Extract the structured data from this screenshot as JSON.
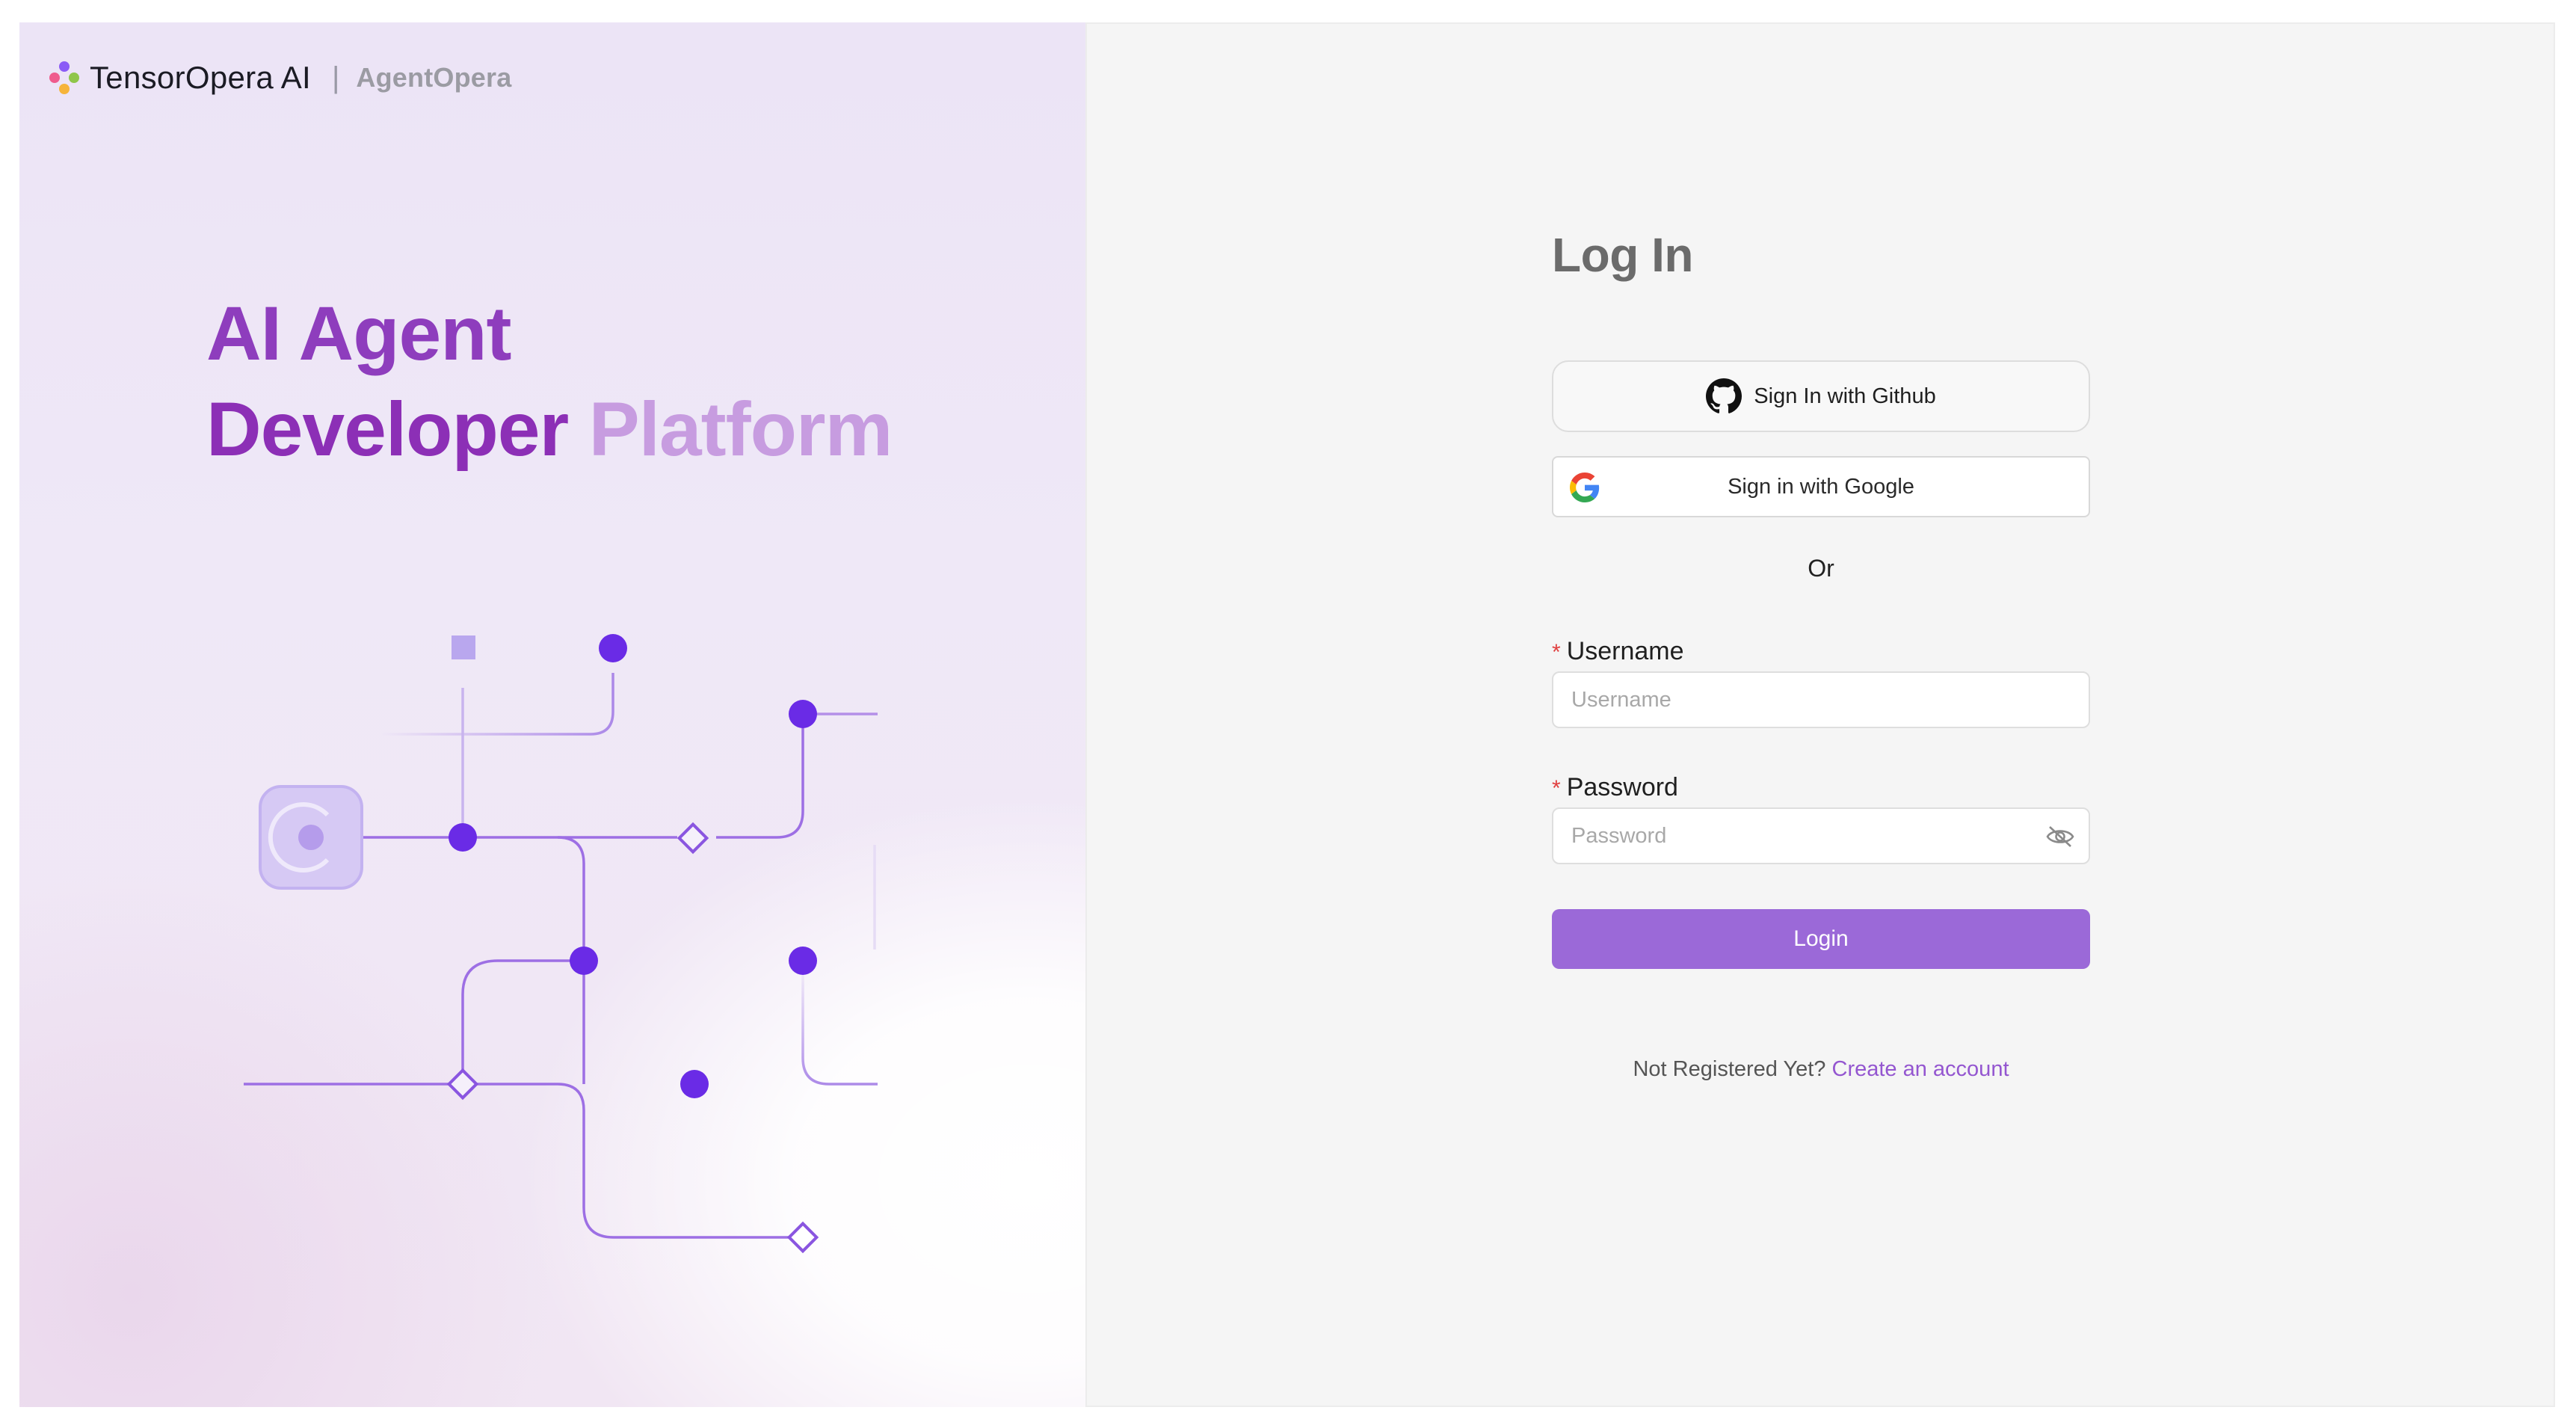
{
  "brand": {
    "name": "TensorOpera AI",
    "separator": "|",
    "product": "AgentOpera"
  },
  "hero": {
    "line1": "AI Agent",
    "line2_part1": "Developer",
    "line2_part2": "Platform"
  },
  "login": {
    "title": "Log In",
    "github_label": "Sign In with Github",
    "google_label": "Sign in with Google",
    "or_text": "Or",
    "required_mark": "*",
    "username_label": "Username",
    "username_placeholder": "Username",
    "password_label": "Password",
    "password_placeholder": "Password",
    "submit_label": "Login",
    "register_prompt": "Not Registered Yet?",
    "register_link": "Create an account"
  },
  "icons": {
    "brand_logo": "tensoropera-logo-icon",
    "github": "github-icon",
    "google": "google-icon",
    "password_toggle": "eye-off-icon"
  },
  "colors": {
    "accent": "#9b69d8",
    "link": "#9456d0",
    "hero_primary": "#8c2fb6",
    "hero_light": "#c79ce0",
    "node": "#6a2be6",
    "required": "#e04040"
  }
}
